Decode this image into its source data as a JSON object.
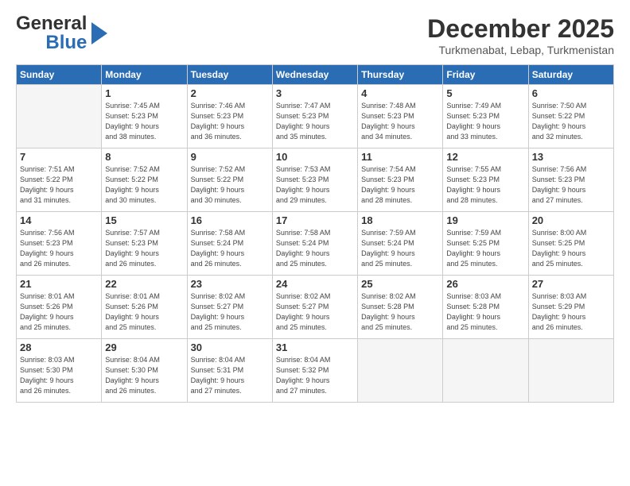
{
  "header": {
    "logo_general": "General",
    "logo_blue": "Blue",
    "month_title": "December 2025",
    "location": "Turkmenabat, Lebap, Turkmenistan"
  },
  "days_of_week": [
    "Sunday",
    "Monday",
    "Tuesday",
    "Wednesday",
    "Thursday",
    "Friday",
    "Saturday"
  ],
  "weeks": [
    [
      {
        "day": "",
        "info": ""
      },
      {
        "day": "1",
        "info": "Sunrise: 7:45 AM\nSunset: 5:23 PM\nDaylight: 9 hours\nand 38 minutes."
      },
      {
        "day": "2",
        "info": "Sunrise: 7:46 AM\nSunset: 5:23 PM\nDaylight: 9 hours\nand 36 minutes."
      },
      {
        "day": "3",
        "info": "Sunrise: 7:47 AM\nSunset: 5:23 PM\nDaylight: 9 hours\nand 35 minutes."
      },
      {
        "day": "4",
        "info": "Sunrise: 7:48 AM\nSunset: 5:23 PM\nDaylight: 9 hours\nand 34 minutes."
      },
      {
        "day": "5",
        "info": "Sunrise: 7:49 AM\nSunset: 5:23 PM\nDaylight: 9 hours\nand 33 minutes."
      },
      {
        "day": "6",
        "info": "Sunrise: 7:50 AM\nSunset: 5:22 PM\nDaylight: 9 hours\nand 32 minutes."
      }
    ],
    [
      {
        "day": "7",
        "info": "Sunrise: 7:51 AM\nSunset: 5:22 PM\nDaylight: 9 hours\nand 31 minutes."
      },
      {
        "day": "8",
        "info": "Sunrise: 7:52 AM\nSunset: 5:22 PM\nDaylight: 9 hours\nand 30 minutes."
      },
      {
        "day": "9",
        "info": "Sunrise: 7:52 AM\nSunset: 5:22 PM\nDaylight: 9 hours\nand 30 minutes."
      },
      {
        "day": "10",
        "info": "Sunrise: 7:53 AM\nSunset: 5:23 PM\nDaylight: 9 hours\nand 29 minutes."
      },
      {
        "day": "11",
        "info": "Sunrise: 7:54 AM\nSunset: 5:23 PM\nDaylight: 9 hours\nand 28 minutes."
      },
      {
        "day": "12",
        "info": "Sunrise: 7:55 AM\nSunset: 5:23 PM\nDaylight: 9 hours\nand 28 minutes."
      },
      {
        "day": "13",
        "info": "Sunrise: 7:56 AM\nSunset: 5:23 PM\nDaylight: 9 hours\nand 27 minutes."
      }
    ],
    [
      {
        "day": "14",
        "info": "Sunrise: 7:56 AM\nSunset: 5:23 PM\nDaylight: 9 hours\nand 26 minutes."
      },
      {
        "day": "15",
        "info": "Sunrise: 7:57 AM\nSunset: 5:23 PM\nDaylight: 9 hours\nand 26 minutes."
      },
      {
        "day": "16",
        "info": "Sunrise: 7:58 AM\nSunset: 5:24 PM\nDaylight: 9 hours\nand 26 minutes."
      },
      {
        "day": "17",
        "info": "Sunrise: 7:58 AM\nSunset: 5:24 PM\nDaylight: 9 hours\nand 25 minutes."
      },
      {
        "day": "18",
        "info": "Sunrise: 7:59 AM\nSunset: 5:24 PM\nDaylight: 9 hours\nand 25 minutes."
      },
      {
        "day": "19",
        "info": "Sunrise: 7:59 AM\nSunset: 5:25 PM\nDaylight: 9 hours\nand 25 minutes."
      },
      {
        "day": "20",
        "info": "Sunrise: 8:00 AM\nSunset: 5:25 PM\nDaylight: 9 hours\nand 25 minutes."
      }
    ],
    [
      {
        "day": "21",
        "info": "Sunrise: 8:01 AM\nSunset: 5:26 PM\nDaylight: 9 hours\nand 25 minutes."
      },
      {
        "day": "22",
        "info": "Sunrise: 8:01 AM\nSunset: 5:26 PM\nDaylight: 9 hours\nand 25 minutes."
      },
      {
        "day": "23",
        "info": "Sunrise: 8:02 AM\nSunset: 5:27 PM\nDaylight: 9 hours\nand 25 minutes."
      },
      {
        "day": "24",
        "info": "Sunrise: 8:02 AM\nSunset: 5:27 PM\nDaylight: 9 hours\nand 25 minutes."
      },
      {
        "day": "25",
        "info": "Sunrise: 8:02 AM\nSunset: 5:28 PM\nDaylight: 9 hours\nand 25 minutes."
      },
      {
        "day": "26",
        "info": "Sunrise: 8:03 AM\nSunset: 5:28 PM\nDaylight: 9 hours\nand 25 minutes."
      },
      {
        "day": "27",
        "info": "Sunrise: 8:03 AM\nSunset: 5:29 PM\nDaylight: 9 hours\nand 26 minutes."
      }
    ],
    [
      {
        "day": "28",
        "info": "Sunrise: 8:03 AM\nSunset: 5:30 PM\nDaylight: 9 hours\nand 26 minutes."
      },
      {
        "day": "29",
        "info": "Sunrise: 8:04 AM\nSunset: 5:30 PM\nDaylight: 9 hours\nand 26 minutes."
      },
      {
        "day": "30",
        "info": "Sunrise: 8:04 AM\nSunset: 5:31 PM\nDaylight: 9 hours\nand 27 minutes."
      },
      {
        "day": "31",
        "info": "Sunrise: 8:04 AM\nSunset: 5:32 PM\nDaylight: 9 hours\nand 27 minutes."
      },
      {
        "day": "",
        "info": ""
      },
      {
        "day": "",
        "info": ""
      },
      {
        "day": "",
        "info": ""
      }
    ]
  ]
}
